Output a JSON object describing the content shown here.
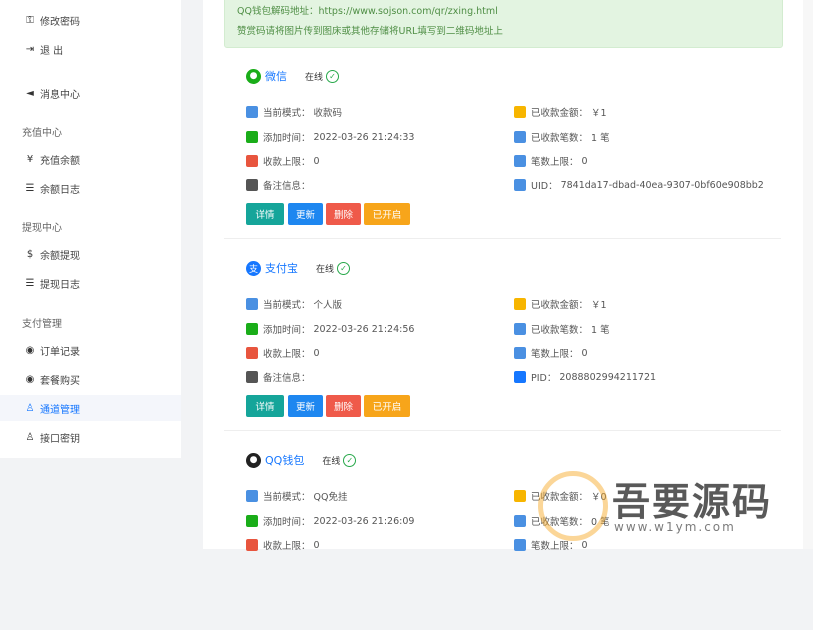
{
  "sidebar": {
    "items_top": [
      {
        "label": "修改密码",
        "icon": "key-icon",
        "glyph": "⚿"
      },
      {
        "label": "退 出",
        "icon": "logout-icon",
        "glyph": "⇥"
      },
      {
        "label": "消息中心",
        "icon": "megaphone-icon",
        "glyph": "◄"
      }
    ],
    "sections": [
      {
        "title": "充值中心",
        "items": [
          {
            "label": "充值余额",
            "icon": "yen-icon",
            "glyph": "¥"
          },
          {
            "label": "余额日志",
            "icon": "list-icon",
            "glyph": "☰"
          }
        ]
      },
      {
        "title": "提现中心",
        "items": [
          {
            "label": "余额提现",
            "icon": "dollar-icon",
            "glyph": "$"
          },
          {
            "label": "提现日志",
            "icon": "list-icon",
            "glyph": "☰"
          }
        ]
      },
      {
        "title": "支付管理",
        "items": [
          {
            "label": "订单记录",
            "icon": "user-circle-icon",
            "glyph": "◉"
          },
          {
            "label": "套餐购买",
            "icon": "user-circle-icon",
            "glyph": "◉"
          },
          {
            "label": "通道管理",
            "icon": "user-icon",
            "glyph": "♙",
            "active": true
          },
          {
            "label": "接口密钥",
            "icon": "user-icon",
            "glyph": "♙"
          }
        ]
      }
    ]
  },
  "notice": {
    "line1": "QQ钱包解码地址：https://www.sojson.com/qr/zxing.html",
    "line2": "赞赏码请将图片传到图床或其他存储将URL填写到二维码地址上"
  },
  "channels": [
    {
      "name": "微信",
      "icon": "wechat-icon",
      "icon_color": "#1aad19",
      "icon_glyph": "●",
      "status": "在线",
      "left": [
        {
          "label": "当前模式：",
          "value": "收款码",
          "icon": "mode-icon",
          "color": "#4a90e2"
        },
        {
          "label": "添加时间：",
          "value": "2022-03-26 21:24:33",
          "icon": "clock-icon",
          "color": "#1aad19"
        },
        {
          "label": "收款上限：",
          "value": "0",
          "icon": "limit-icon",
          "color": "#e8553e"
        },
        {
          "label": "备注信息：",
          "value": "",
          "icon": "edit-icon",
          "color": "#555555"
        }
      ],
      "right": [
        {
          "label": "已收款金额：",
          "value": "￥1",
          "icon": "coin-icon",
          "color": "#f7b500"
        },
        {
          "label": "已收款笔数：",
          "value": "1 笔",
          "icon": "count-icon",
          "color": "#4a90e2"
        },
        {
          "label": "笔数上限：",
          "value": "0",
          "icon": "cap-icon",
          "color": "#4a90e2"
        },
        {
          "label": "UID：",
          "value": "7841da17-dbad-40ea-9307-0bf60e908bb2",
          "icon": "uid-icon",
          "color": "#4a90e2"
        }
      ]
    },
    {
      "name": "支付宝",
      "icon": "alipay-icon",
      "icon_color": "#1677ff",
      "icon_glyph": "支",
      "status": "在线",
      "left": [
        {
          "label": "当前模式：",
          "value": "个人版",
          "icon": "mode-icon",
          "color": "#4a90e2"
        },
        {
          "label": "添加时间：",
          "value": "2022-03-26 21:24:56",
          "icon": "clock-icon",
          "color": "#1aad19"
        },
        {
          "label": "收款上限：",
          "value": "0",
          "icon": "limit-icon",
          "color": "#e8553e"
        },
        {
          "label": "备注信息：",
          "value": "",
          "icon": "edit-icon",
          "color": "#555555"
        }
      ],
      "right": [
        {
          "label": "已收款金额：",
          "value": "￥1",
          "icon": "coin-icon",
          "color": "#f7b500"
        },
        {
          "label": "已收款笔数：",
          "value": "1 笔",
          "icon": "count-icon",
          "color": "#4a90e2"
        },
        {
          "label": "笔数上限：",
          "value": "0",
          "icon": "cap-icon",
          "color": "#4a90e2"
        },
        {
          "label": "PID：",
          "value": "2088802994211721",
          "icon": "pid-icon",
          "color": "#1677ff"
        }
      ]
    },
    {
      "name": "QQ钱包",
      "icon": "qq-penguin-icon",
      "icon_color": "#222222",
      "icon_glyph": "●",
      "status": "在线",
      "left": [
        {
          "label": "当前模式：",
          "value": "QQ免挂",
          "icon": "mode-icon",
          "color": "#4a90e2"
        },
        {
          "label": "添加时间：",
          "value": "2022-03-26 21:26:09",
          "icon": "clock-icon",
          "color": "#1aad19"
        },
        {
          "label": "收款上限：",
          "value": "0",
          "icon": "limit-icon",
          "color": "#e8553e"
        }
      ],
      "right": [
        {
          "label": "已收款金额：",
          "value": "￥0",
          "icon": "coin-icon",
          "color": "#f7b500"
        },
        {
          "label": "已收款笔数：",
          "value": "0 笔",
          "icon": "count-icon",
          "color": "#4a90e2"
        },
        {
          "label": "笔数上限：",
          "value": "0",
          "icon": "cap-icon",
          "color": "#4a90e2"
        }
      ]
    }
  ],
  "buttons": {
    "detail": "详情",
    "update": "更新",
    "delete": "删除",
    "enabled": "已开启"
  },
  "watermark": {
    "text": "吾要源码",
    "url": "www.w1ym.com"
  }
}
